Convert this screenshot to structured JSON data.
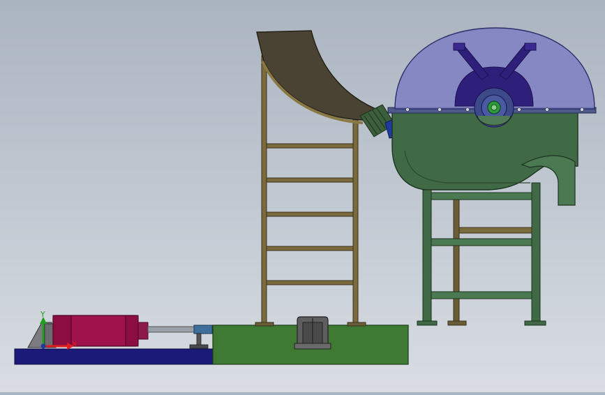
{
  "viewport": {
    "background_top": "#aab4c0",
    "background_bottom": "#d9dde3"
  },
  "triad": {
    "x_label": "X",
    "y_label": "Y",
    "x_color": "#e02020",
    "y_color": "#20a020"
  },
  "colors": {
    "base_plate": "#1c1a78",
    "green_platform": "#3e7a33",
    "cylinder": "#a0124a",
    "chute": "#4a4232",
    "frame": "#7a6a3c",
    "tank": "#3f6a45",
    "dome": "#7e7fc2",
    "rotor": "#2e1f7a",
    "bellows": "#3a5f3a",
    "bearing": "#5e5e5e"
  }
}
